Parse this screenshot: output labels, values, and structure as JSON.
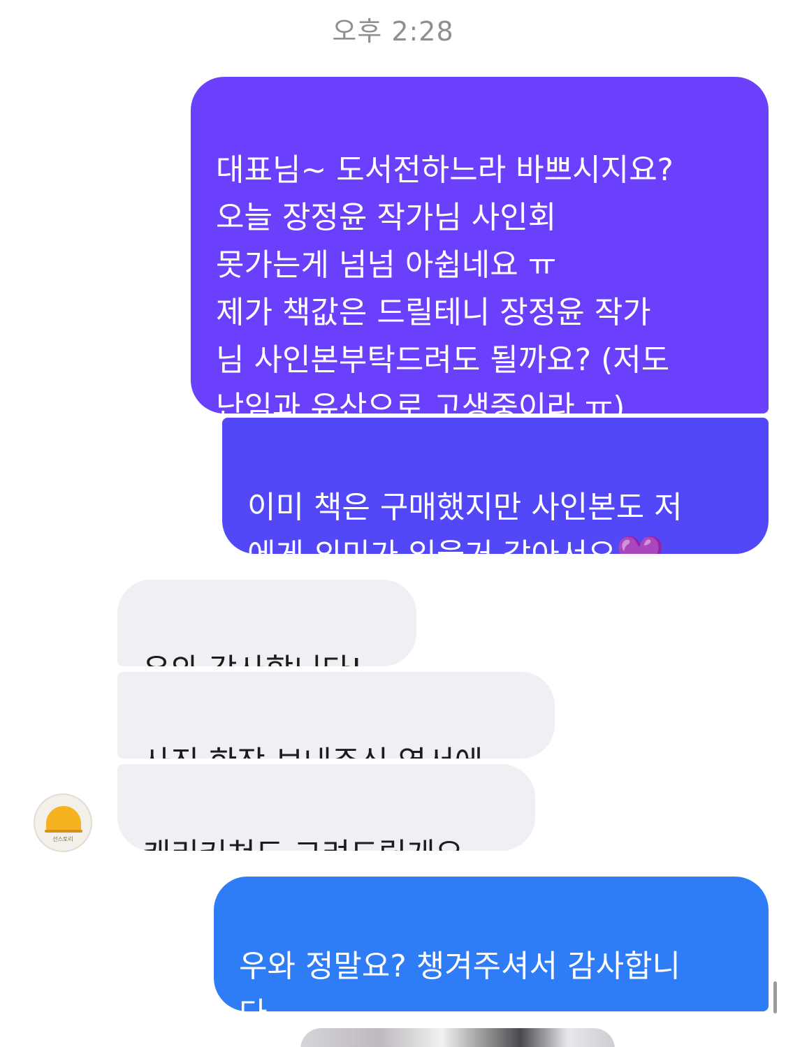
{
  "conversation": {
    "timestamp": "오후 2:28",
    "messages": [
      {
        "sender": "me",
        "text": "대표님~ 도서전하느라 바쁘시지요?\n오늘 장정윤 작가님 사인회\n못가는게 넘넘 아쉽네요 ㅠ\n제가 책값은 드릴테니 장정윤 작가\n님 사인본부탁드려도 될까요? (저도\n난임과 유산으로 고생중이라 ㅠ)"
      },
      {
        "sender": "me",
        "text": "이미 책은 구매했지만 사인본도 저\n에게 의미가 있을거 같아서요",
        "emoji": "💜"
      },
      {
        "sender": "other",
        "text": "우와 감사합니다!"
      },
      {
        "sender": "other",
        "text": "사진 한장 보내주심 엽서에"
      },
      {
        "sender": "other",
        "text": "캐리커쳐도 그려드릴게요"
      },
      {
        "sender": "me",
        "text": "우와 정말요? 챙겨주셔서 감사합니\n다"
      }
    ],
    "other_avatar": {
      "label": "선스토리",
      "icon": "sun-book-logo-icon"
    }
  },
  "colors": {
    "bubble_out_gradient_top": "#6a40fc",
    "bubble_out_gradient_mid": "#5248f7",
    "bubble_out_gradient_bottom": "#2e7cf6",
    "bubble_in": "#efeff4",
    "timestamp": "#8e8e93"
  }
}
